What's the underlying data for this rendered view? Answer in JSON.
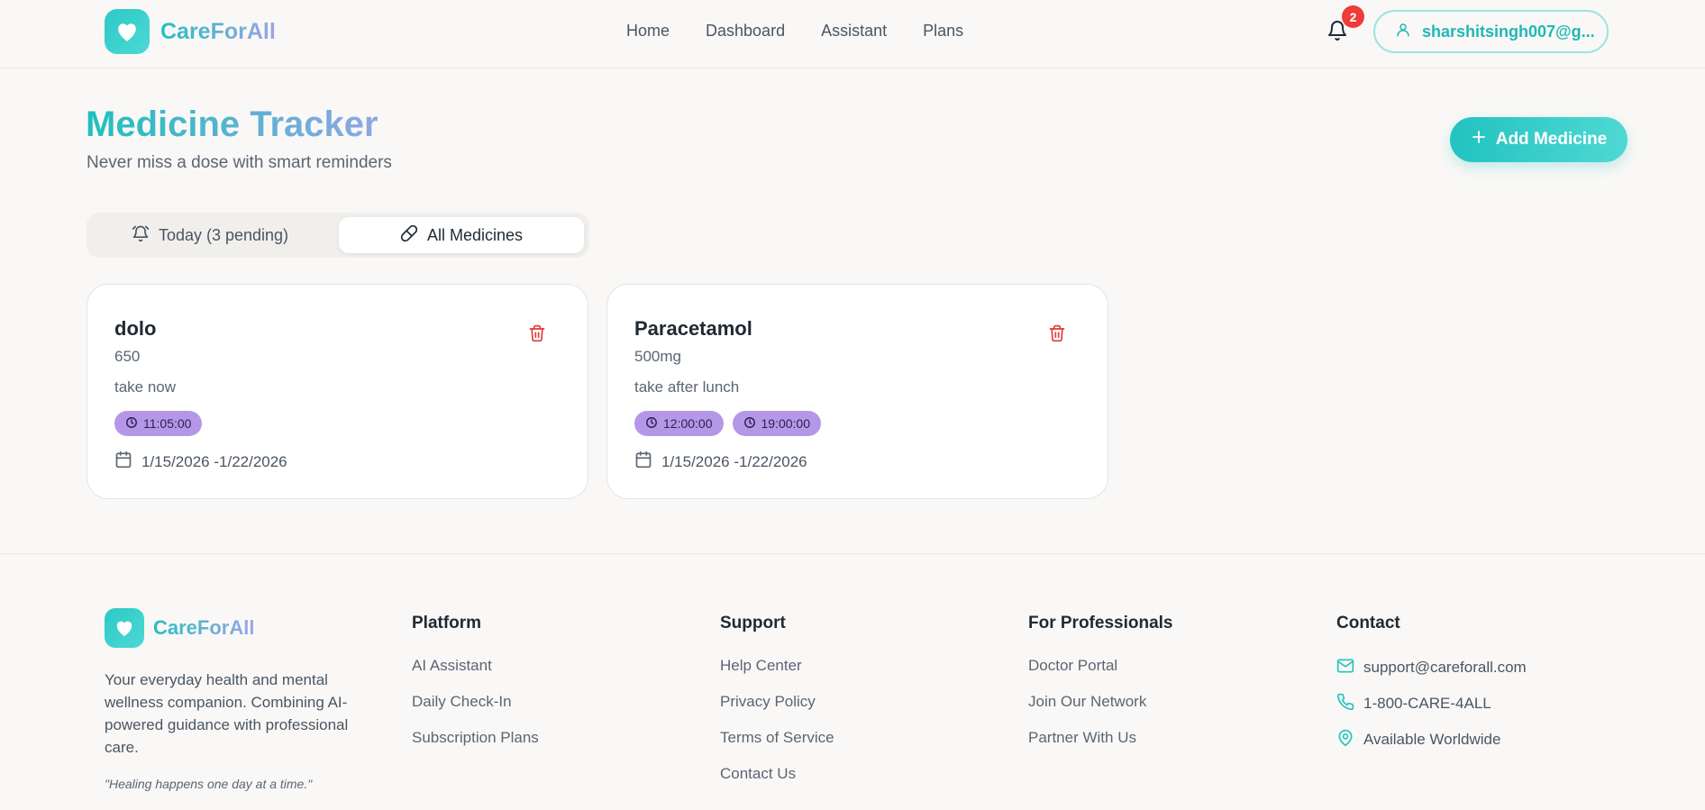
{
  "header": {
    "brand": "CareForAll",
    "nav": [
      "Home",
      "Dashboard",
      "Assistant",
      "Plans"
    ],
    "notification_count": "2",
    "user_email": "sharshitsingh007@g..."
  },
  "page": {
    "title": "Medicine Tracker",
    "subtitle": "Never miss a dose with smart reminders",
    "add_button": "Add Medicine"
  },
  "tabs": {
    "today": "Today (3 pending)",
    "all": "All Medicines",
    "active": "all"
  },
  "medicines": [
    {
      "name": "dolo",
      "dose": "650",
      "note": "take now",
      "times": [
        "11:05:00"
      ],
      "dates": "1/15/2026 -1/22/2026"
    },
    {
      "name": "Paracetamol",
      "dose": "500mg",
      "note": "take after lunch",
      "times": [
        "12:00:00",
        "19:00:00"
      ],
      "dates": "1/15/2026 -1/22/2026"
    }
  ],
  "footer": {
    "brand": "CareForAll",
    "description": "Your everyday health and mental wellness companion. Combining AI-powered guidance with professional care.",
    "quote": "\"Healing happens one day at a time.\"",
    "platform": {
      "title": "Platform",
      "links": [
        "AI Assistant",
        "Daily Check-In",
        "Subscription Plans"
      ]
    },
    "support": {
      "title": "Support",
      "links": [
        "Help Center",
        "Privacy Policy",
        "Terms of Service",
        "Contact Us"
      ]
    },
    "professionals": {
      "title": "For Professionals",
      "links": [
        "Doctor Portal",
        "Join Our Network",
        "Partner With Us"
      ]
    },
    "contact": {
      "title": "Contact",
      "email": "support@careforall.com",
      "phone": "1-800-CARE-4ALL",
      "location": "Available Worldwide"
    }
  },
  "colors": {
    "accent": "#22c3c0",
    "time_chip": "#b597e8",
    "danger": "#ef3b3b"
  },
  "icons": [
    "heart-icon",
    "bell-icon",
    "user-icon",
    "plus-icon",
    "alarm-icon",
    "pill-icon",
    "trash-icon",
    "clock-icon",
    "calendar-icon",
    "mail-icon",
    "phone-icon",
    "map-pin-icon"
  ]
}
